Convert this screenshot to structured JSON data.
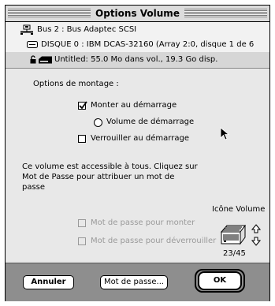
{
  "window": {
    "title": "Options Volume"
  },
  "bus": {
    "label": "Bus 2 : Bus Adaptec SCSI"
  },
  "disk": {
    "label": "DISQUE 0 :  IBM    DCAS-32160 (Array 2:0, disque 1 de 6"
  },
  "volume": {
    "label": "Untitled: 55.0 Mo dans vol., 19.3 Go disp."
  },
  "mount": {
    "heading": "Options de montage :",
    "startup_mount": {
      "label": "Monter au démarrage",
      "checked": true
    },
    "startup_volume": {
      "label": "Volume de démarrage",
      "selected": false
    },
    "startup_lock": {
      "label": "Verrouiller au démarrage",
      "checked": false
    }
  },
  "info": {
    "line1": "Ce volume est accessible à tous. Cliquez sur",
    "line2": "Mot de Passe pour attribuer un mot de",
    "line3": "passe"
  },
  "password": {
    "mount_label": "Mot de passe pour monter",
    "unlock_label": "Mot de passe pour déverrouiller",
    "enabled": false
  },
  "icon_panel": {
    "label": "Icône Volume",
    "counter": "23/45"
  },
  "buttons": {
    "cancel": "Annuler",
    "password": "Mot de passe...",
    "ok": "OK"
  }
}
